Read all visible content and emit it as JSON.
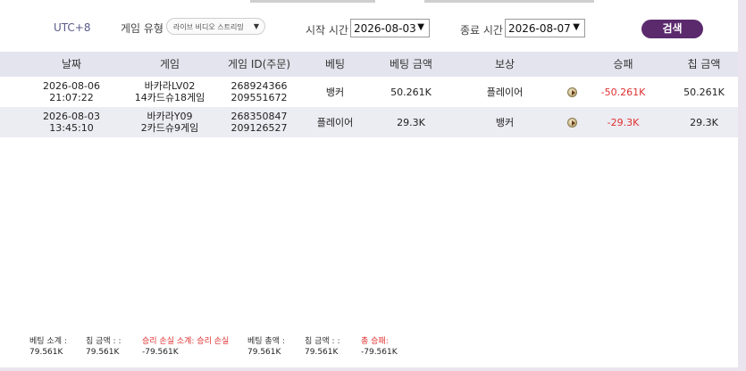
{
  "filter": {
    "timezone": "UTC+8",
    "game_type_label": "게임 유형",
    "game_type_value": "라이브 비디오 스트리밍",
    "start_label": "시작 시간",
    "start_date": "2026-08-03",
    "end_label": "종료 시간",
    "end_date": "2026-08-07",
    "search_label": "검색"
  },
  "table": {
    "headers": [
      "날짜",
      "게임",
      "게임 ID(주문)",
      "베팅",
      "베팅 금액",
      "보상",
      "승패",
      "칩 금액"
    ],
    "rows": [
      {
        "date": "2026-08-06",
        "time": "21:07:22",
        "game_line1": "바카라LV02",
        "game_line2": "14카드슈18게임",
        "id_line1": "268924366",
        "id_line2": "209551672",
        "bet": "뱅커",
        "bet_amount": "50.261K",
        "reward": "플레이어",
        "win_loss": "-50.261K",
        "chip_amount": "50.261K"
      },
      {
        "date": "2026-08-03",
        "time": "13:45:10",
        "game_line1": "바카라Y09",
        "game_line2": "2카드슈9게임",
        "id_line1": "268350847",
        "id_line2": "209126527",
        "bet": "플레이어",
        "bet_amount": "29.3K",
        "reward": "뱅커",
        "win_loss": "-29.3K",
        "chip_amount": "29.3K"
      }
    ]
  },
  "summary": [
    {
      "label": "베팅 소계 :",
      "value": "79.561K",
      "red": false
    },
    {
      "label": "칩 금액 : :",
      "value": "79.561K",
      "red": false
    },
    {
      "label": "승리 손실 소계: 승리 손실",
      "value": "-79.561K",
      "red": true
    },
    {
      "label": "베팅 총액 :",
      "value": "79.561K",
      "red": false
    },
    {
      "label": "칩 금액 : :",
      "value": "79.561K",
      "red": false
    },
    {
      "label": "총 승패:",
      "value": "-79.561K",
      "red": true
    }
  ],
  "colors": {
    "accent": "#5b2a6d",
    "negative": "#e03030",
    "header_bg": "#e4e4ee",
    "alt_row": "#ececf3"
  }
}
